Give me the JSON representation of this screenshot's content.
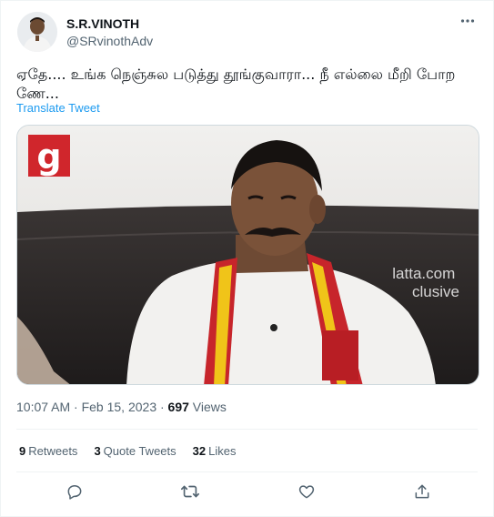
{
  "author": {
    "display_name": "S.R.VINOTH",
    "handle": "@SRvinothAdv",
    "avatar_icon": "profile-avatar"
  },
  "tweet": {
    "text": "ஏதே.... உங்க நெஞ்சுல படுத்து தூங்குவாரா... நீ எல்லை மீறி போற ணே...",
    "translate_label": "Translate Tweet",
    "media_watermark": "galatta.com exclusive",
    "media_logo_letter": "g"
  },
  "meta": {
    "time_date": "10:07 AM · Feb 15, 2023 · ",
    "views_count": "697",
    "views_label": " Views"
  },
  "stats": {
    "retweets_count": "9",
    "retweets_label": "Retweets",
    "quotes_count": "3",
    "quotes_label": "Quote Tweets",
    "likes_count": "32",
    "likes_label": "Likes"
  },
  "icons": {
    "more": "more-dots-icon",
    "reply": "reply-icon",
    "retweet": "retweet-icon",
    "like": "heart-icon",
    "share": "share-icon"
  },
  "colors": {
    "link": "#1d9bf0",
    "secondary_text": "#536471",
    "primary_text": "#0f1419",
    "logo_red": "#d0262c"
  }
}
